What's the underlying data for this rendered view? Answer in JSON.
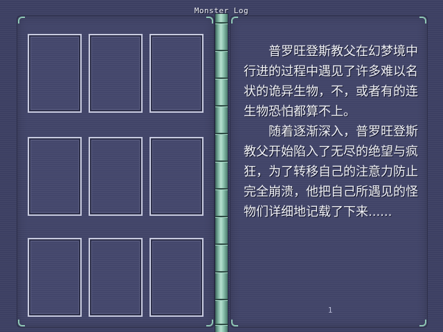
{
  "book": {
    "title": "Monster Log",
    "page_number": "1"
  },
  "left_page": {
    "slots": [
      {
        "row": 1,
        "col": 1,
        "state": "empty"
      },
      {
        "row": 1,
        "col": 2,
        "state": "empty"
      },
      {
        "row": 1,
        "col": 3,
        "state": "empty"
      },
      {
        "row": 2,
        "col": 1,
        "state": "empty"
      },
      {
        "row": 2,
        "col": 2,
        "state": "empty"
      },
      {
        "row": 2,
        "col": 3,
        "state": "empty"
      },
      {
        "row": 3,
        "col": 1,
        "state": "empty"
      },
      {
        "row": 3,
        "col": 2,
        "state": "empty"
      },
      {
        "row": 3,
        "col": 3,
        "state": "empty"
      }
    ]
  },
  "right_page": {
    "paragraphs": [
      "普罗旺登斯教父在幻梦境中行进的过程中遇见了许多难以名状的诡异生物，不，或者有的连生物恐怕都算不上。",
      "随着逐渐深入，普罗旺登斯教父开始陷入了无尽的绝望与疯狂，为了转移自己的注意力防止完全崩溃，他把自己所遇见的怪物们详细地记载了下来......"
    ]
  },
  "colors": {
    "background": "#3c3f62",
    "page": "#414468",
    "slot_border": "#c9cce0",
    "spine": "#8ec4b0",
    "text": "#f1f2f7"
  },
  "icons": {
    "corner_ornament": "corner-bracket-icon"
  }
}
